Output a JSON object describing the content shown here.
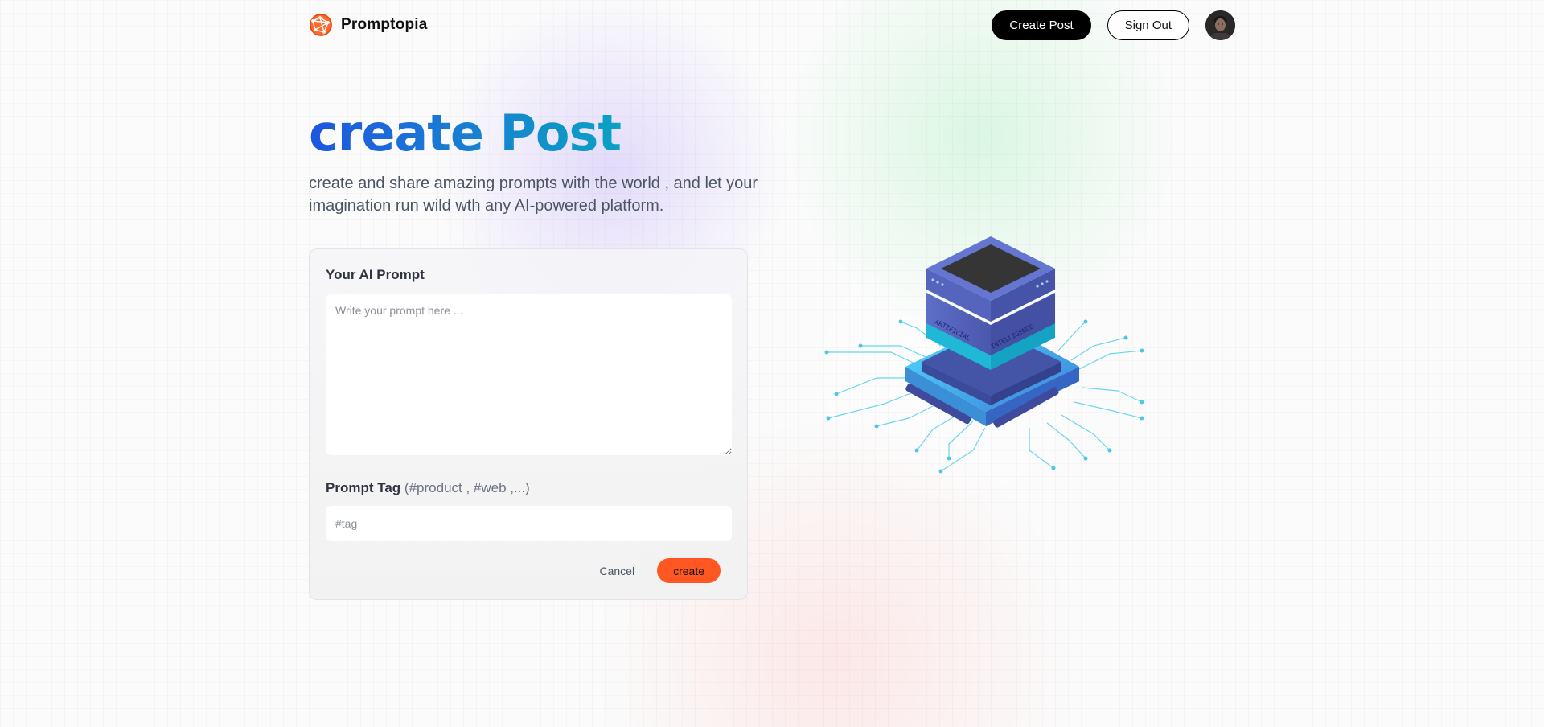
{
  "app": {
    "name": "Promptopia",
    "logo_icon": "globe-logo-icon",
    "brand_color": "#ff5722"
  },
  "nav": {
    "create_post_label": "Create Post",
    "sign_out_label": "Sign Out",
    "avatar_icon": "user-avatar"
  },
  "hero": {
    "title": "create Post",
    "description": "create and share amazing prompts with the world , and let your imagination run wild wth any AI-powered platform.",
    "title_gradient": [
      "#1d55e0",
      "#0aa2c2"
    ]
  },
  "form": {
    "prompt_label": "Your AI Prompt",
    "prompt_value": "",
    "prompt_placeholder": "Write your prompt here ...",
    "tag_label": "Prompt Tag",
    "tag_hint": "(#product , #web ,...)",
    "tag_value": "",
    "tag_placeholder": "#tag",
    "cancel_label": "Cancel",
    "submit_label": "create"
  },
  "illustration": {
    "icon": "ai-server-chip-illustration",
    "text_left": "ARTIFICIAL",
    "text_right": "INTELLIGENCE"
  }
}
